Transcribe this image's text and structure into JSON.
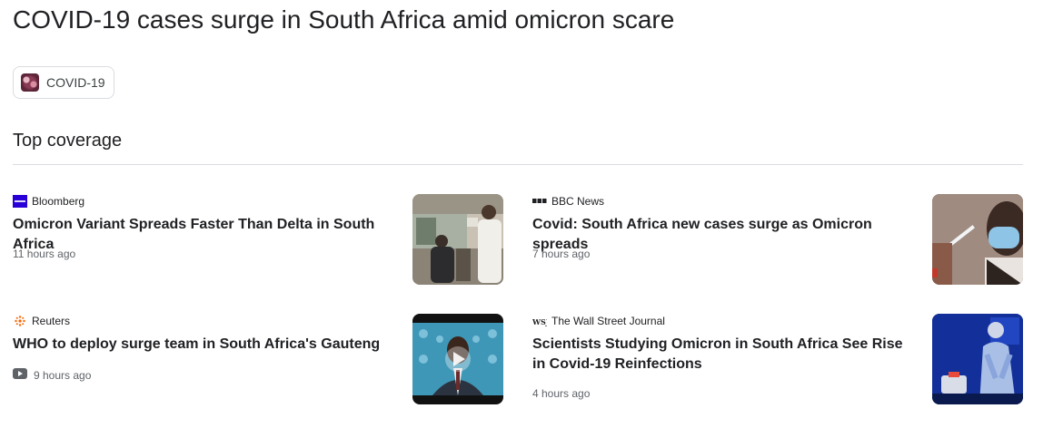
{
  "page": {
    "title": "COVID-19 cases surge in South Africa amid omicron scare"
  },
  "topic_chip": {
    "label": "COVID-19",
    "icon": "covid-thumbnail-icon"
  },
  "section": {
    "title": "Top coverage"
  },
  "articles": [
    {
      "source": "Bloomberg",
      "source_icon": "bloomberg-logo-icon",
      "headline": "Omicron Variant Spreads Faster Than Delta in South Africa",
      "time": "11 hours ago",
      "has_video": false
    },
    {
      "source": "BBC News",
      "source_icon": "bbc-logo-icon",
      "headline": "Covid: South Africa new cases surge as Omicron spreads",
      "time": "7 hours ago",
      "has_video": false
    },
    {
      "source": "Reuters",
      "source_icon": "reuters-logo-icon",
      "headline": "WHO to deploy surge team in South Africa's Gauteng",
      "time": "9 hours ago",
      "has_video": true
    },
    {
      "source": "The Wall Street Journal",
      "source_icon": "wsj-logo-icon",
      "headline": "Scientists Studying Omicron in South Africa See Rise in Covid-19 Reinfections",
      "time": "4 hours ago",
      "has_video": false
    }
  ],
  "colors": {
    "text_primary": "#202124",
    "text_secondary": "#5f6368",
    "divider": "#dadce0",
    "bloomberg_blue": "#2800d7",
    "reuters_orange": "#fa6400"
  }
}
